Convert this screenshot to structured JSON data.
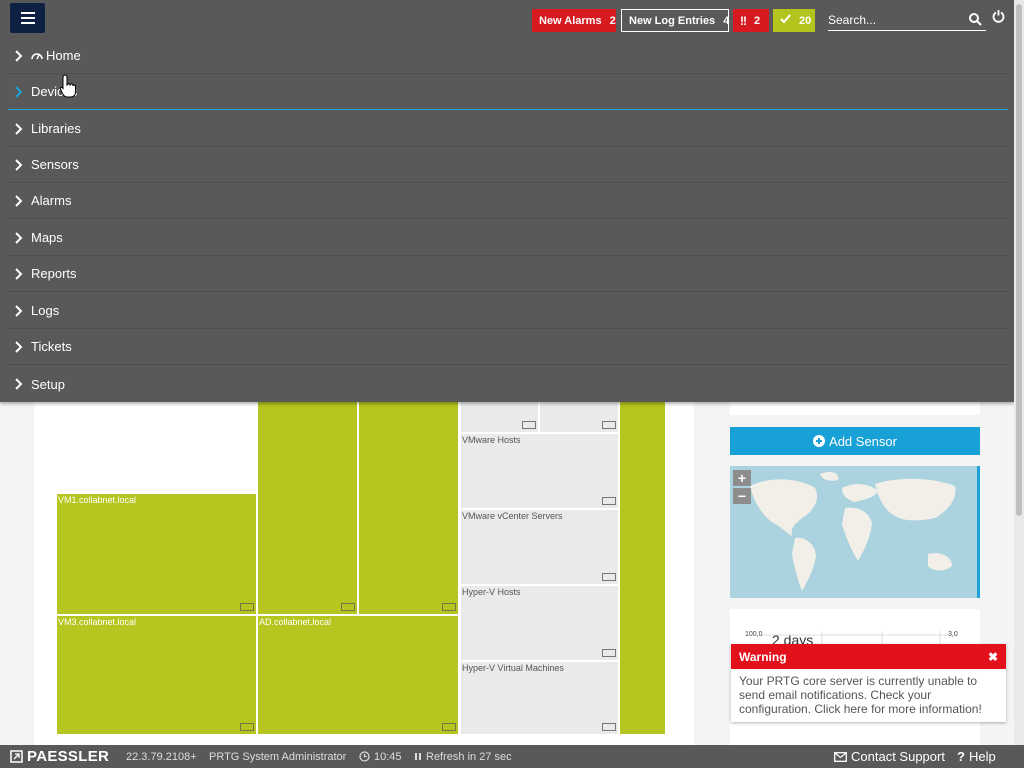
{
  "header": {
    "new_alarms_label": "New Alarms",
    "new_alarms_count": "2",
    "new_log_label": "New Log Entries",
    "new_log_count": "4",
    "down_count": "2",
    "up_count": "20",
    "search_placeholder": "Search..."
  },
  "nav": {
    "items": [
      {
        "label": "Home"
      },
      {
        "label": "Devices"
      },
      {
        "label": "Libraries"
      },
      {
        "label": "Sensors"
      },
      {
        "label": "Alarms"
      },
      {
        "label": "Maps"
      },
      {
        "label": "Reports"
      },
      {
        "label": "Logs"
      },
      {
        "label": "Tickets"
      },
      {
        "label": "Setup"
      }
    ]
  },
  "treemap": {
    "tiles": [
      {
        "label": "",
        "status": "down"
      },
      {
        "label": "VM1.collabnet.local",
        "status": "up"
      },
      {
        "label": "VM3.collabnet.local",
        "status": "up"
      },
      {
        "label": "",
        "status": "up"
      },
      {
        "label": "",
        "status": "up"
      },
      {
        "label": "AD.collabnet.local",
        "status": "up"
      },
      {
        "label": "",
        "status": "empty"
      },
      {
        "label": "",
        "status": "empty"
      },
      {
        "label": "VMware Hosts",
        "status": "empty"
      },
      {
        "label": "VMware vCenter Servers",
        "status": "empty"
      },
      {
        "label": "Hyper-V Hosts",
        "status": "empty"
      },
      {
        "label": "Hyper-V Virtual Machines",
        "status": "empty"
      },
      {
        "label": "",
        "status": "up"
      }
    ]
  },
  "sidebar": {
    "add_sensor_label": "Add Sensor",
    "zoom_in": "+",
    "zoom_out": "−",
    "graph_label": "2 days",
    "graph_y_left": "100,0",
    "graph_y_right": "3,0"
  },
  "warning": {
    "title": "Warning",
    "close": "✖",
    "message": "Your PRTG core server is currently unable to send email notifications. Check your configuration. Click here for more information!"
  },
  "footer": {
    "brand": "PAESSLER",
    "version": "22.3.79.2108+",
    "user": "PRTG System Administrator",
    "time": "10:45",
    "refresh": "Refresh in 27 sec",
    "contact": "Contact Support",
    "help": "Help"
  },
  "colors": {
    "topbar": "#595959",
    "alarm_red": "#d71920",
    "up_green": "#b6c51f",
    "accent_blue": "#18a1d6",
    "menu_button": "#0f2143"
  }
}
